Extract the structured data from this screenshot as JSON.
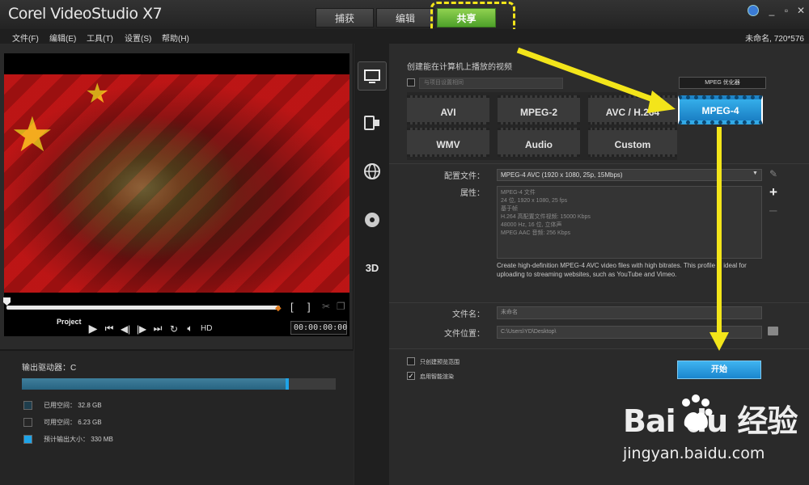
{
  "app": {
    "title": "Corel VideoStudio X7"
  },
  "mode_tabs": {
    "capture": "捕获",
    "edit": "编辑",
    "share": "共享"
  },
  "window_controls": {
    "minimize": "_",
    "restore": "▫",
    "close": "✕"
  },
  "menu": {
    "items": [
      "文件(F)",
      "编辑(E)",
      "工具(T)",
      "设置(S)",
      "帮助(H)"
    ],
    "project_info": "未命名, 720*576"
  },
  "preview": {
    "project_label": "Project",
    "timecode": "00:00:00:00",
    "hd_label": "HD",
    "mark_in": "[",
    "mark_out": "]",
    "scrub_position": 0.0
  },
  "drive": {
    "label": "输出驱动器：C",
    "used_fraction": 0.84,
    "legend": [
      {
        "label": "已用空间：",
        "value": "32.8 GB",
        "color": "#1f3e4d"
      },
      {
        "label": "可用空间：",
        "value": "6.23 GB",
        "color": "#262626"
      },
      {
        "label": "预计输出大小：",
        "value": "330 MB",
        "color": "#1ea4e8"
      }
    ]
  },
  "share": {
    "heading": "创建能在计算机上播放的视频",
    "device_placeholder": "与项目设置相同",
    "mpeg_optimizer": "MPEG 优化器",
    "formats": [
      "AVI",
      "MPEG-2",
      "AVC / H.264",
      "WMV",
      "Audio",
      "Custom"
    ],
    "selected_format": "MPEG-4",
    "profile_label": "配置文件：",
    "profile_value": "MPEG-4 AVC (1920 x 1080, 25p, 15Mbps)",
    "properties_label": "属性：",
    "properties": [
      "MPEG-4 文件",
      "24 位, 1920 x 1080, 25 fps",
      "基于帧",
      "H.264 高配置文件视频: 15000 Kbps",
      "48000 Hz, 16 位, 立体声",
      "MPEG AAC 音频: 256 Kbps"
    ],
    "description": "Create high-definition MPEG-4 AVC video files with high bitrates. This profile is ideal for uploading to streaming websites, such as YouTube and Vimeo.",
    "filename_label": "文件名：",
    "filename_value": "未命名",
    "location_label": "文件位置：",
    "location_value": "C:\\Users\\YD\\Desktop\\",
    "opt_preview_range": "只创建预览范围",
    "opt_smart_render": "启用智能渲染",
    "start_button": "开始"
  },
  "watermark": {
    "logo": "Bai du 经验",
    "url": "jingyan.baidu.com"
  },
  "colors": {
    "accent_blue": "#1b8fd6",
    "highlight_yellow": "#f3e51a",
    "share_green": "#5fb535"
  }
}
